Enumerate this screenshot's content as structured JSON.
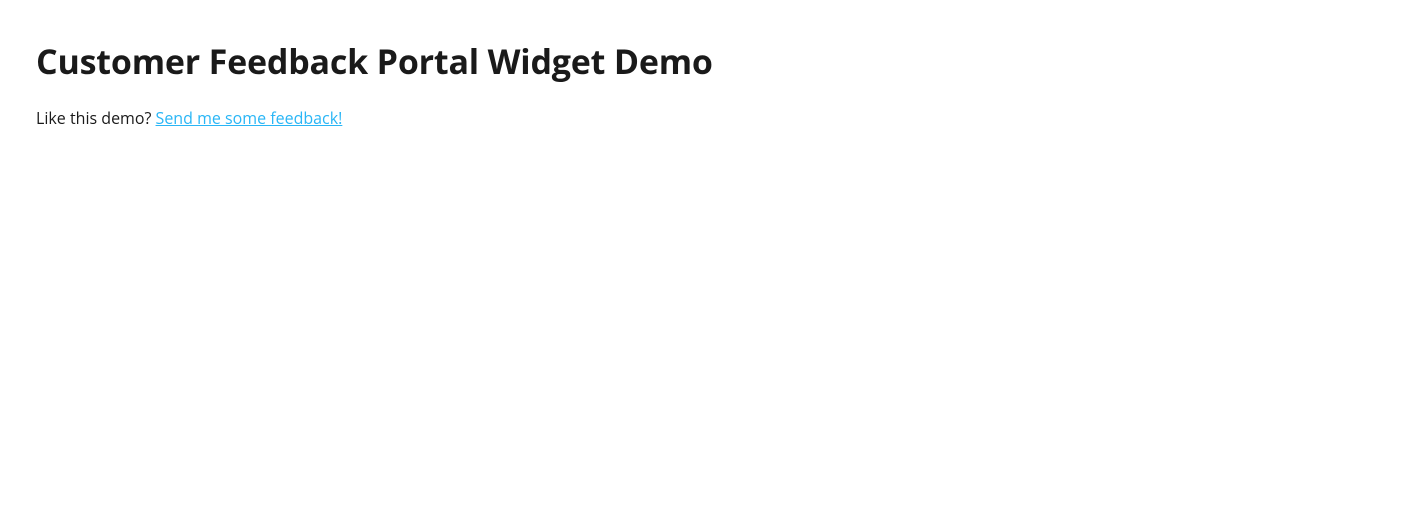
{
  "page": {
    "title": "Customer Feedback Portal Widget Demo",
    "prompt_text": "Like this demo? ",
    "link_text": "Send me some feedback!"
  }
}
